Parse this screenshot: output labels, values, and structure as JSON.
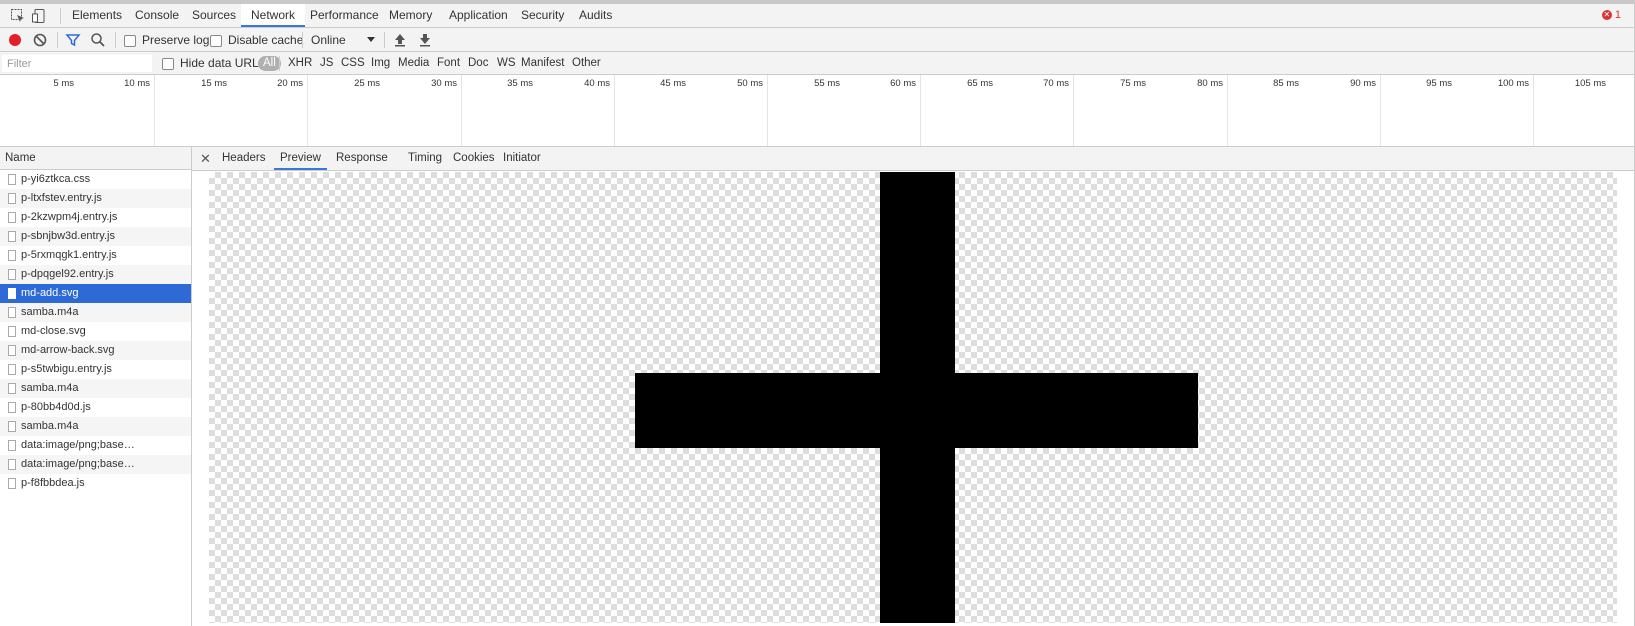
{
  "main_tabs": [
    "Elements",
    "Console",
    "Sources",
    "Network",
    "Performance",
    "Memory",
    "Application",
    "Security",
    "Audits"
  ],
  "active_main_tab": "Network",
  "error_count": "1",
  "toolbar": {
    "preserve_log": "Preserve log",
    "disable_cache": "Disable cache",
    "throttle": "Online"
  },
  "filter": {
    "placeholder": "Filter",
    "hide_data_urls": "Hide data URLs",
    "types": [
      "All",
      "XHR",
      "JS",
      "CSS",
      "Img",
      "Media",
      "Font",
      "Doc",
      "WS",
      "Manifest",
      "Other"
    ],
    "active_type": "All"
  },
  "timeline_ticks": [
    "5 ms",
    "10 ms",
    "15 ms",
    "20 ms",
    "25 ms",
    "30 ms",
    "35 ms",
    "40 ms",
    "45 ms",
    "50 ms",
    "55 ms",
    "60 ms",
    "65 ms",
    "70 ms",
    "75 ms",
    "80 ms",
    "85 ms",
    "90 ms",
    "95 ms",
    "100 ms",
    "105 ms"
  ],
  "name_header": "Name",
  "requests": [
    "p-yi6ztkca.css",
    "p-ltxfstev.entry.js",
    "p-2kzwpm4j.entry.js",
    "p-sbnjbw3d.entry.js",
    "p-5rxmqgk1.entry.js",
    "p-dpqgel92.entry.js",
    "md-add.svg",
    "samba.m4a",
    "md-close.svg",
    "md-arrow-back.svg",
    "p-s5twbigu.entry.js",
    "samba.m4a",
    "p-80bb4d0d.js",
    "samba.m4a",
    "data:image/png;base…",
    "data:image/png;base…",
    "p-f8fbbdea.js"
  ],
  "selected_request": "md-add.svg",
  "detail_tabs": [
    "Headers",
    "Preview",
    "Response",
    "Timing",
    "Cookies",
    "Initiator"
  ],
  "active_detail_tab": "Preview",
  "icons": [
    "inspect-icon",
    "device-toggle-icon",
    "record-icon",
    "clear-icon",
    "filter-icon",
    "search-icon",
    "upload-icon",
    "download-icon",
    "close-icon",
    "file-icon"
  ]
}
